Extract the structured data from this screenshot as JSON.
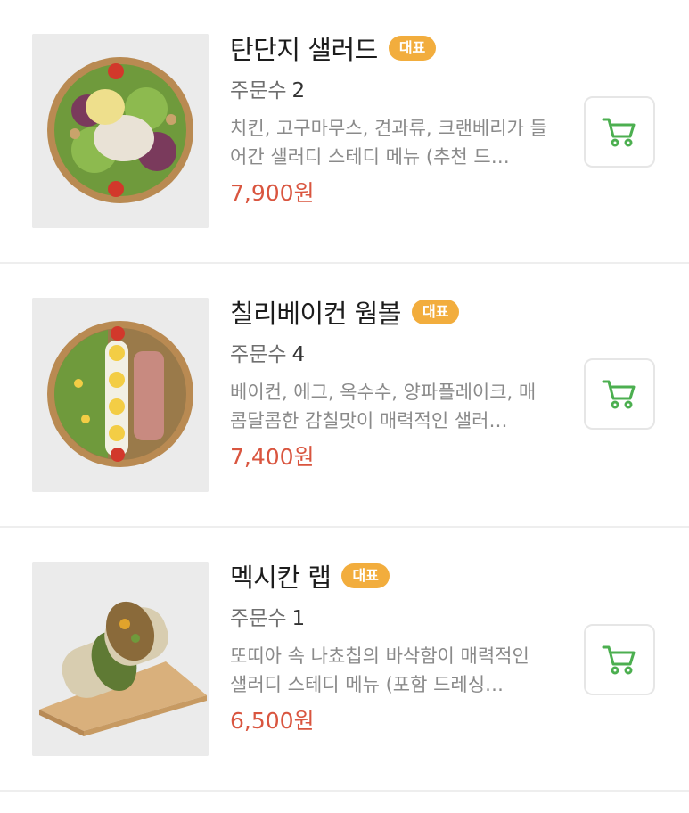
{
  "colors": {
    "badge": "#f2ad3d",
    "price": "#d9553f",
    "cart_icon": "#4caf50",
    "divider": "#eeeeee"
  },
  "menu": [
    {
      "name": "탄단지 샐러드",
      "badge": "대표",
      "orders_label": "주문수",
      "orders": "2",
      "description": "치킨, 고구마무스, 견과류, 크랜베리가 들어간 샐러디 스테디 메뉴 (추천 드…",
      "price": "7,900원",
      "image": "salad-bowl-image",
      "cart_icon": "cart-icon"
    },
    {
      "name": "칠리베이컨 웜볼",
      "badge": "대표",
      "orders_label": "주문수",
      "orders": "4",
      "description": "베이컨, 에그, 옥수수, 양파플레이크, 매콤달콤한 감칠맛이 매력적인 샐러…",
      "price": "7,400원",
      "image": "warm-bowl-image",
      "cart_icon": "cart-icon"
    },
    {
      "name": "멕시칸 랩",
      "badge": "대표",
      "orders_label": "주문수",
      "orders": "1",
      "description": "또띠아 속 나쵸칩의 바삭함이 매력적인 샐러디 스테디 메뉴 (포함 드레싱…",
      "price": "6,500원",
      "image": "wrap-image",
      "cart_icon": "cart-icon"
    }
  ]
}
